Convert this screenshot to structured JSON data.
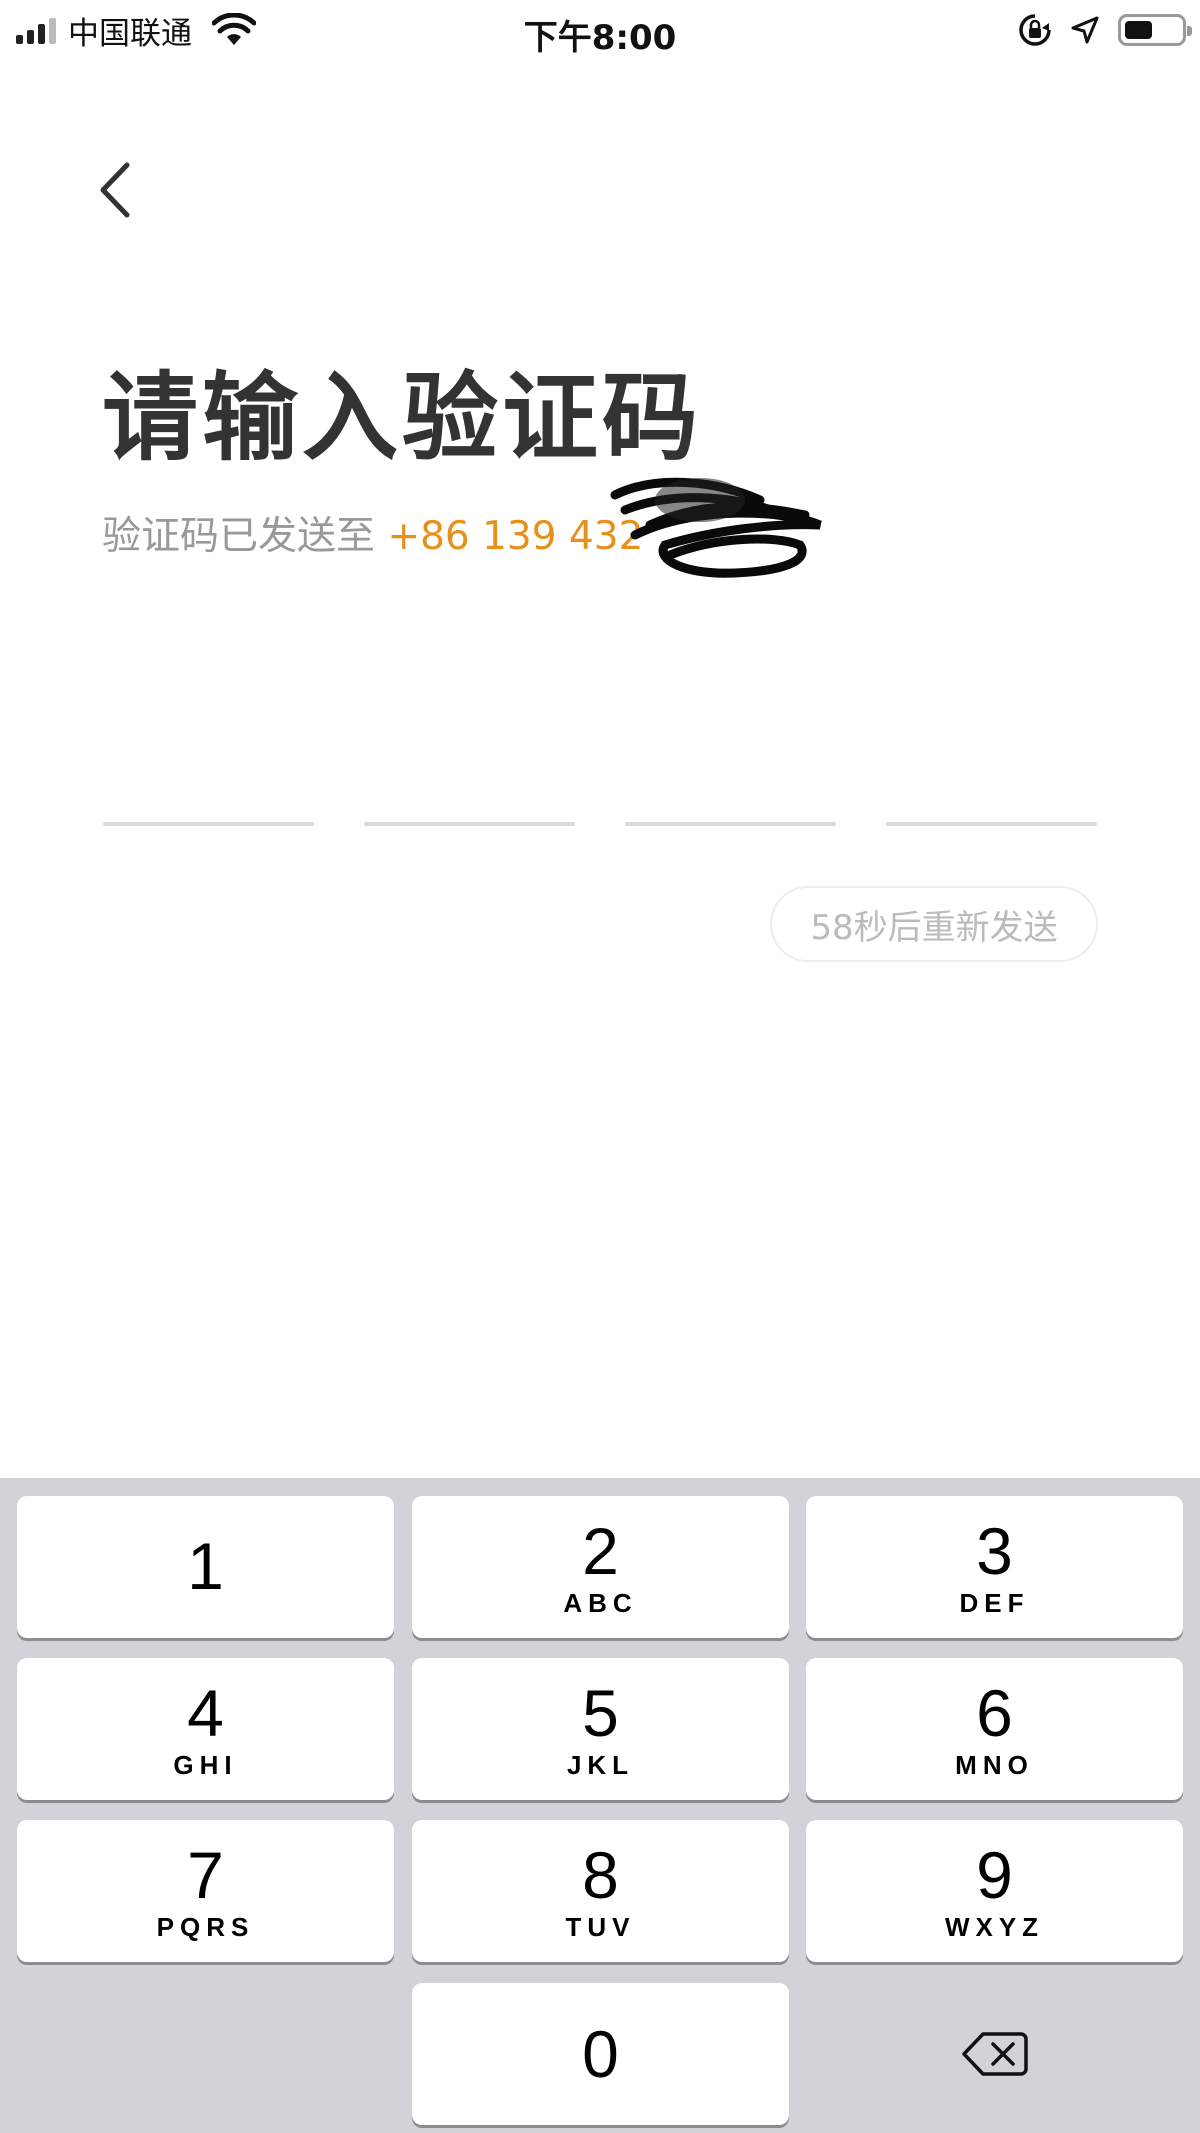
{
  "status_bar": {
    "carrier": "中国联通",
    "time": "下午8:00",
    "battery_level": 0.5
  },
  "header": {
    "back_icon": "chevron-left-icon"
  },
  "main": {
    "title": "请输入验证码",
    "subtitle_prefix": "验证码已发送至",
    "phone": "+86 139 432",
    "code_length": 4,
    "resend_label": "58秒后重新发送"
  },
  "keypad": {
    "keys": [
      {
        "num": "1",
        "letters": ""
      },
      {
        "num": "2",
        "letters": "ABC"
      },
      {
        "num": "3",
        "letters": "DEF"
      },
      {
        "num": "4",
        "letters": "GHI"
      },
      {
        "num": "5",
        "letters": "JKL"
      },
      {
        "num": "6",
        "letters": "MNO"
      },
      {
        "num": "7",
        "letters": "PQRS"
      },
      {
        "num": "8",
        "letters": "TUV"
      },
      {
        "num": "9",
        "letters": "WXYZ"
      },
      {
        "num": "0",
        "letters": ""
      }
    ],
    "delete_icon": "backspace-icon"
  },
  "colors": {
    "accent": "#e8901c",
    "keypad_bg": "#d1d3d9",
    "text_primary": "#333333",
    "text_secondary": "#999999"
  }
}
